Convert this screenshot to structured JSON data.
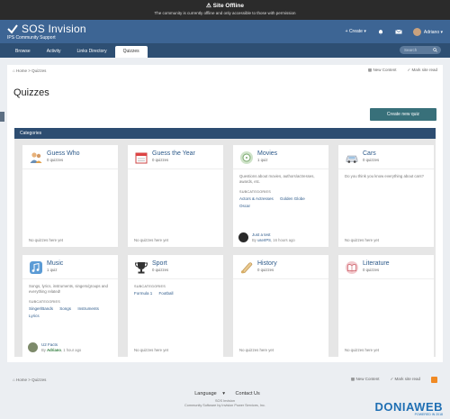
{
  "offline_banner": {
    "title": "Site Offline",
    "message": "The community is currently offline and only accessible to those with permission"
  },
  "header": {
    "logo_name": "SOS Invision",
    "logo_sub": "IPS Community Support",
    "create_label": "Create",
    "user_name": "Adriano"
  },
  "nav": {
    "tabs": [
      {
        "label": "Browse"
      },
      {
        "label": "Activity"
      },
      {
        "label": "Links Directory"
      },
      {
        "label": "Quizzes"
      }
    ],
    "active_tab": "Quizzes",
    "search_placeholder": "Search"
  },
  "breadcrumb": {
    "home": "Home",
    "sep": ">",
    "current": "Quizzes",
    "new_content": "New Content",
    "mark_read": "Mark site read"
  },
  "page": {
    "title": "Quizzes",
    "create_button": "Create new quiz",
    "categories_label": "Categories"
  },
  "categories": [
    {
      "name": "Guess Who",
      "count": "0 quizzes",
      "footer": "No quizzes here yet",
      "icon": "people-icon"
    },
    {
      "name": "Guess the Year",
      "count": "0 quizzes",
      "footer": "No quizzes here yet",
      "icon": "calendar-icon"
    },
    {
      "name": "Movies",
      "count": "1 quiz",
      "description": "Questions about movies, authors/actresses, awards, etc.",
      "subcategories_label": "SUBCATEGORIES",
      "subcategories": [
        "Actors & Actresses",
        "Golden Globe",
        "Oscar"
      ],
      "latest_title": "Just a test",
      "latest_by": "By",
      "latest_user": "userIPS",
      "latest_time": "16 hours ago",
      "icon": "film-icon"
    },
    {
      "name": "Cars",
      "count": "0 quizzes",
      "description": "Do you think you know everything about cars?",
      "footer": "No quizzes here yet",
      "icon": "car-icon"
    },
    {
      "name": "Music",
      "count": "1 quiz",
      "description": "Songs, lyrics, instruments, singers/groups and everything related!",
      "subcategories_label": "SUBCATEGORIES",
      "subcategories": [
        "Singer/Bands",
        "Songs",
        "Instruments",
        "Lyrics"
      ],
      "latest_title": "U2 Facts",
      "latest_by": "By",
      "latest_user": "Adriano",
      "latest_time": "1 hour ago",
      "icon": "music-icon"
    },
    {
      "name": "Sport",
      "count": "0 quizzes",
      "subcategories_label": "SUBCATEGORIES",
      "subcategories": [
        "Formula 1",
        "Football"
      ],
      "footer": "No quizzes here yet",
      "icon": "trophy-icon"
    },
    {
      "name": "History",
      "count": "0 quizzes",
      "footer": "No quizzes here yet",
      "icon": "scroll-icon"
    },
    {
      "name": "Literature",
      "count": "0 quizzes",
      "footer": "No quizzes here yet",
      "icon": "book-icon"
    }
  ],
  "footer": {
    "language": "Language",
    "contact": "Contact Us",
    "site": "SOS Invision",
    "powered": "Community Software by Invision Power Services, Inc."
  },
  "watermark": {
    "name": "DONIAWEB",
    "sub": "POWERED IN 2018"
  },
  "colors": {
    "header": "#3d6594",
    "nav": "#2e4f73",
    "button": "#38707a",
    "link": "#2d5a8a"
  }
}
